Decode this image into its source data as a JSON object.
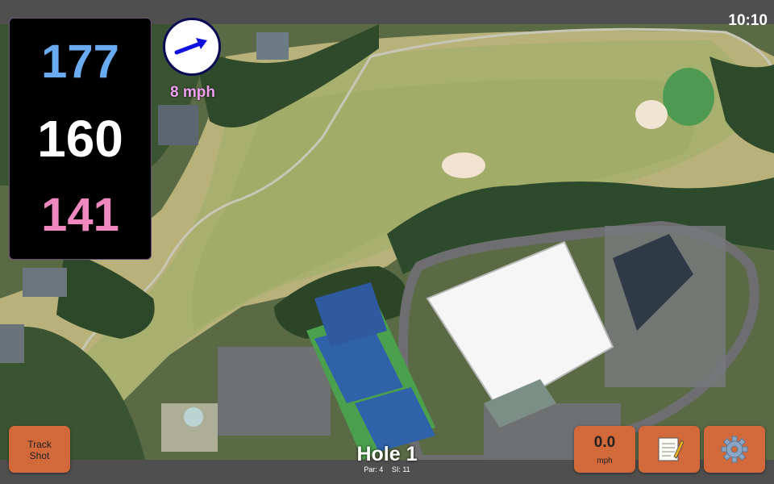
{
  "status": {
    "time": "10:10"
  },
  "yardages": {
    "back": "177",
    "middle": "160",
    "front": "141",
    "back_color": "#6aaaf0",
    "front_color": "#f088c0"
  },
  "wind": {
    "speed": "8 mph",
    "arrow_color": "#1111dd",
    "label_color": "#f0a0f0"
  },
  "buttons": {
    "track_shot_line1": "Track",
    "track_shot_line2": "Shot",
    "speed_value": "0.0",
    "speed_unit": "mph",
    "notes_icon": "notepad-icon",
    "settings_icon": "gear-icon",
    "button_color": "#d2693a"
  },
  "hole": {
    "title": "Hole 1",
    "par": "Par: 4",
    "si": "SI: 11"
  },
  "map": {
    "type": "satellite",
    "fairway_color": "#b8b47a",
    "green_color": "#4f9a52",
    "tree_color": "#2f4a2a"
  }
}
